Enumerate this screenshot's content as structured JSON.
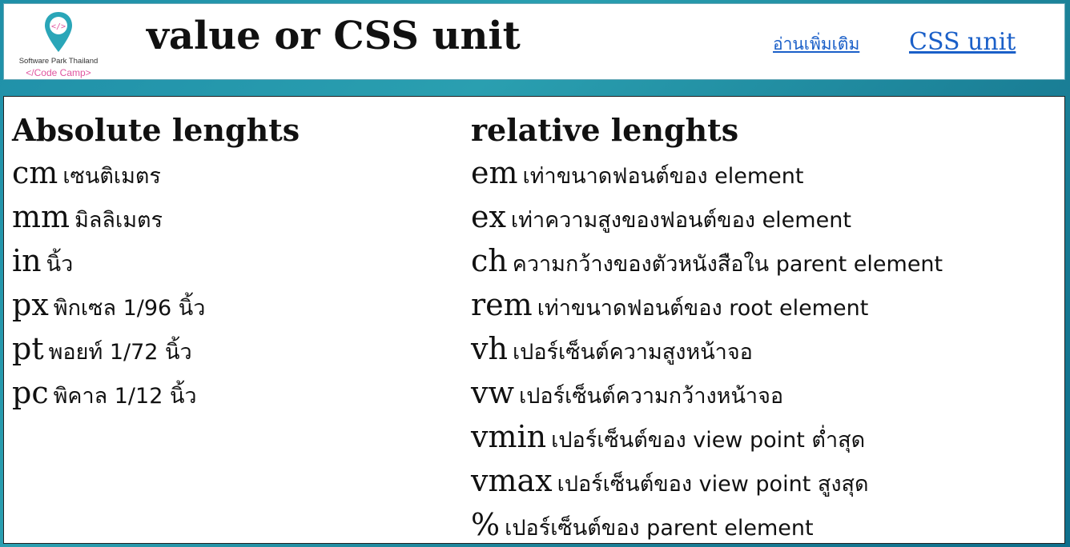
{
  "header": {
    "logo": {
      "icon": "code-location-pin-icon",
      "name": "Software Park Thailand",
      "tagline": "</Code Camp>",
      "pin_color": "#2aa6b8",
      "tagline_color": "#e0559f"
    },
    "title": "value or CSS unit",
    "links": {
      "read_more": "อ่านเพิ่มเติม",
      "css_unit": "CSS unit"
    },
    "link_color": "#1a5fc8"
  },
  "absolute": {
    "heading": "Absolute lenghts",
    "items": [
      {
        "unit": "cm",
        "desc": "เซนติเมตร"
      },
      {
        "unit": "mm",
        "desc": "มิลลิเมตร"
      },
      {
        "unit": "in",
        "desc": "นิ้ว"
      },
      {
        "unit": "px",
        "desc": "พิกเซล 1/96 นิ้ว"
      },
      {
        "unit": "pt",
        "desc": "พอยท์ 1/72 นิ้ว"
      },
      {
        "unit": "pc",
        "desc": "พิคาล 1/12 นิ้ว"
      }
    ]
  },
  "relative": {
    "heading": "relative lenghts",
    "items": [
      {
        "unit": "em",
        "desc": "เท่าขนาดฟอนต์ของ element"
      },
      {
        "unit": "ex",
        "desc": "เท่าความสูงของฟอนต์ของ element"
      },
      {
        "unit": "ch",
        "desc": "ความกว้างของตัวหนังสือใน parent element"
      },
      {
        "unit": "rem",
        "desc": "เท่าขนาดฟอนต์ของ root element"
      },
      {
        "unit": "vh",
        "desc": "เปอร์เซ็นต์ความสูงหน้าจอ"
      },
      {
        "unit": "vw",
        "desc": "เปอร์เซ็นต์ความกว้างหน้าจอ"
      },
      {
        "unit": "vmin",
        "desc": "เปอร์เซ็นต์ของ view point ต่ำสุด"
      },
      {
        "unit": "vmax",
        "desc": "เปอร์เซ็นต์ของ view point สูงสุด"
      },
      {
        "unit": "%",
        "desc": "เปอร์เซ็นต์ของ parent element"
      }
    ]
  }
}
